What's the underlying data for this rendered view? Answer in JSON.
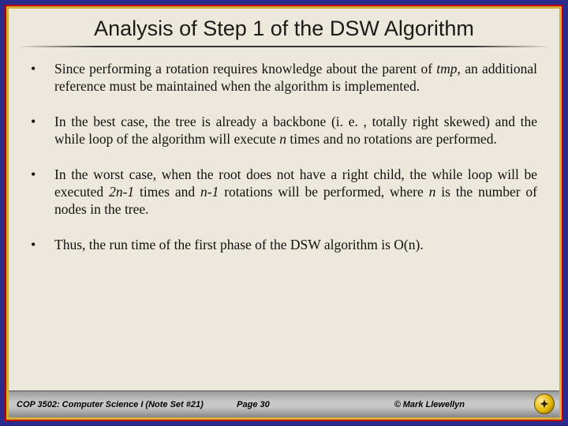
{
  "title": "Analysis of Step 1 of the DSW Algorithm",
  "bullets": [
    {
      "pre": "Since performing a rotation requires knowledge about the parent of ",
      "ital1": "tmp",
      "mid": ", an additional reference must be maintained when the algorithm is implemented.",
      "ital2": "",
      "post": ""
    },
    {
      "pre": "In the best case, the tree is already a backbone (i. e. , totally right skewed) and the while loop of the algorithm will execute ",
      "ital1": "n",
      "mid": " times and no rotations are performed.",
      "ital2": "",
      "post": ""
    },
    {
      "pre": "In the worst case, when the root does not have a right child, the while loop will be executed ",
      "ital1": "2n-1",
      "mid": " times and ",
      "ital2": "n-1",
      "post_mid": " rotations will be performed, where ",
      "ital3": "n",
      "post": " is the number of nodes in the tree."
    },
    {
      "pre": "Thus, the run time of the first phase of the DSW algorithm is O(n).",
      "ital1": "",
      "mid": "",
      "ital2": "",
      "post": ""
    }
  ],
  "footer": {
    "left": "COP 3502: Computer Science I  (Note Set #21)",
    "center": "Page 30",
    "right": "© Mark Llewellyn"
  },
  "icon_glyph": "✦"
}
